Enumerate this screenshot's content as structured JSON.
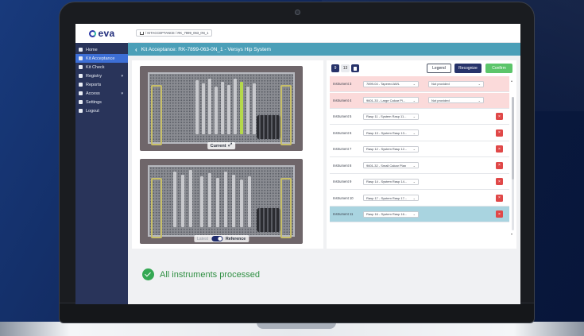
{
  "sidebar": {
    "logo_text": "eva",
    "items": [
      {
        "label": "Home",
        "active": false
      },
      {
        "label": "Kit Acceptance",
        "active": true
      },
      {
        "label": "Kit Check",
        "active": false
      },
      {
        "label": "Registry",
        "active": false,
        "has_chevron": true
      },
      {
        "label": "Reports",
        "active": false
      },
      {
        "label": "Access",
        "active": false,
        "has_chevron": true
      },
      {
        "label": "Settings",
        "active": false
      },
      {
        "label": "Logout",
        "active": false
      }
    ]
  },
  "breadcrumb": {
    "text": "/ KITACCEPTANCE / RK_7899_063_0N_1"
  },
  "page": {
    "title": "Kit Acceptance: RK-7899-063-0N_1 - Versys Hip System"
  },
  "images": {
    "current_label": "Current",
    "toggle_off_label": "Latest",
    "toggle_on_label": "Reference"
  },
  "toolbar": {
    "page_a": "9",
    "page_b": "13",
    "legend_label": "Legend",
    "recognize_label": "Recognize",
    "confirm_label": "Confirm"
  },
  "instruments": [
    {
      "label": "Instrument 3",
      "value": "7899-04 - Tapered AWL",
      "status": "Not provided",
      "state": "warn"
    },
    {
      "label": "Instrument 4",
      "value": "9601-33 - Large Calcar Pl...",
      "status": "Not provided",
      "state": "warn"
    },
    {
      "label": "Instrument 5",
      "value": "Rasp 11 - System Rasp 11...",
      "state": "normal"
    },
    {
      "label": "Instrument 6",
      "value": "Rasp 13 - System Rasp 13...",
      "state": "normal"
    },
    {
      "label": "Instrument 7",
      "value": "Rasp 12 - System Rasp 12...",
      "state": "normal"
    },
    {
      "label": "Instrument 8",
      "value": "9601-32 - Small Calcar Plan",
      "state": "normal"
    },
    {
      "label": "Instrument 9",
      "value": "Rasp 14 - System Rasp 14...",
      "state": "normal"
    },
    {
      "label": "Instrument 10",
      "value": "Rasp 17 - System Rasp 17...",
      "state": "normal"
    },
    {
      "label": "Instrument 11",
      "value": "Rasp 16 - System Rasp 16...",
      "state": "selected"
    }
  ],
  "status": {
    "text": "All instruments processed"
  },
  "colors": {
    "accent": "#4b9fb8",
    "sidebar": "#29345a",
    "active": "#3d6fd6",
    "confirm": "#5cc56a",
    "danger": "#e04848"
  }
}
